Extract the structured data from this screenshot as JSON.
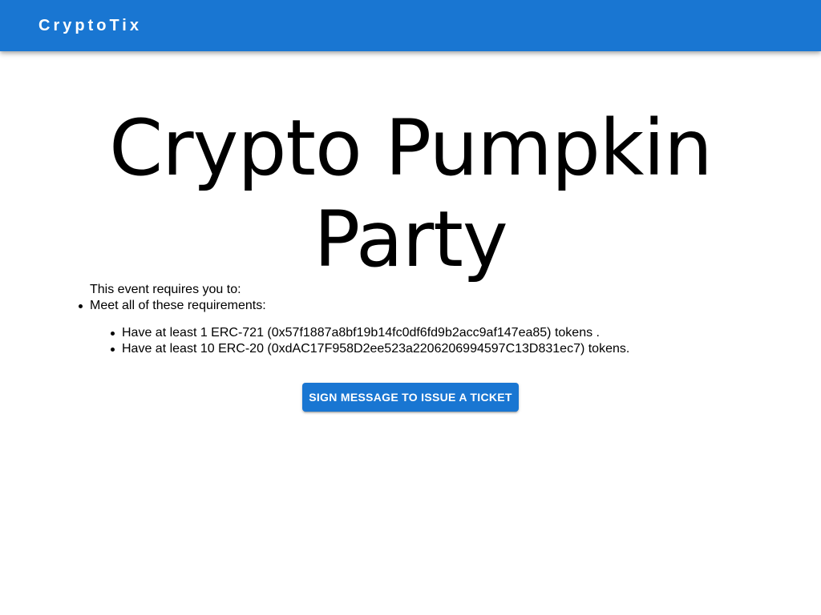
{
  "header": {
    "brand": "CryptoTix",
    "color": "#1976d2"
  },
  "event": {
    "title_line1": "Crypto Pumpkin",
    "title_line2": "Party"
  },
  "requirements": {
    "intro": "This event requires you to:",
    "group_label": "Meet all of these requirements:",
    "items": [
      "Have at least 1 ERC-721 (0x57f1887a8bf19b14fc0df6fd9b2acc9af147ea85) tokens .",
      "Have at least 10 ERC-20 (0xdAC17F958D2ee523a2206206994597C13D831ec7) tokens."
    ]
  },
  "actions": {
    "sign_label": "Sign message to issue a ticket"
  }
}
